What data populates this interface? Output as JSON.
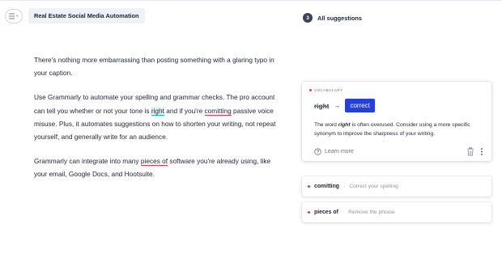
{
  "document": {
    "title": "Real Estate Social Media Automation",
    "paragraphs": {
      "p1": "There's nothing more embarrassing than posting something with a glaring typo in your caption.",
      "p2_a": "Use Grammarly to automate your spelling and grammar checks. The pro account can tell you whether or not your tone is ",
      "p2_right": "right",
      "p2_b": " and if you're ",
      "p2_comitting": "comitting",
      "p2_c": " passive voice misuse. Plus, it automates suggestions on how to shorten your writing, not repeat yourself, and generally write for an audience.",
      "p3_a": "Grammarly can integrate into many ",
      "p3_pieces": "pieces of",
      "p3_b": " software you're already using, like your email, Google Docs, and Hootsuite."
    }
  },
  "suggestions_panel": {
    "count": "3",
    "label": "All suggestions",
    "active_card": {
      "category": "VOCABULARY",
      "original": "right",
      "arrow": "→",
      "replacement": "correct",
      "description_a": "The word ",
      "description_word": "right",
      "description_b": " is often overused. Consider using a more specific synonym to improve the sharpness of your writing.",
      "learn_more": "Learn more",
      "accent_color": "#2540d6"
    },
    "collapsed": [
      {
        "word": "comitting",
        "separator": "·",
        "hint": "Correct your spelling"
      },
      {
        "word": "pieces of",
        "separator": "·",
        "hint": "Remove the phrase"
      }
    ],
    "alert_color": "#e0395b"
  }
}
